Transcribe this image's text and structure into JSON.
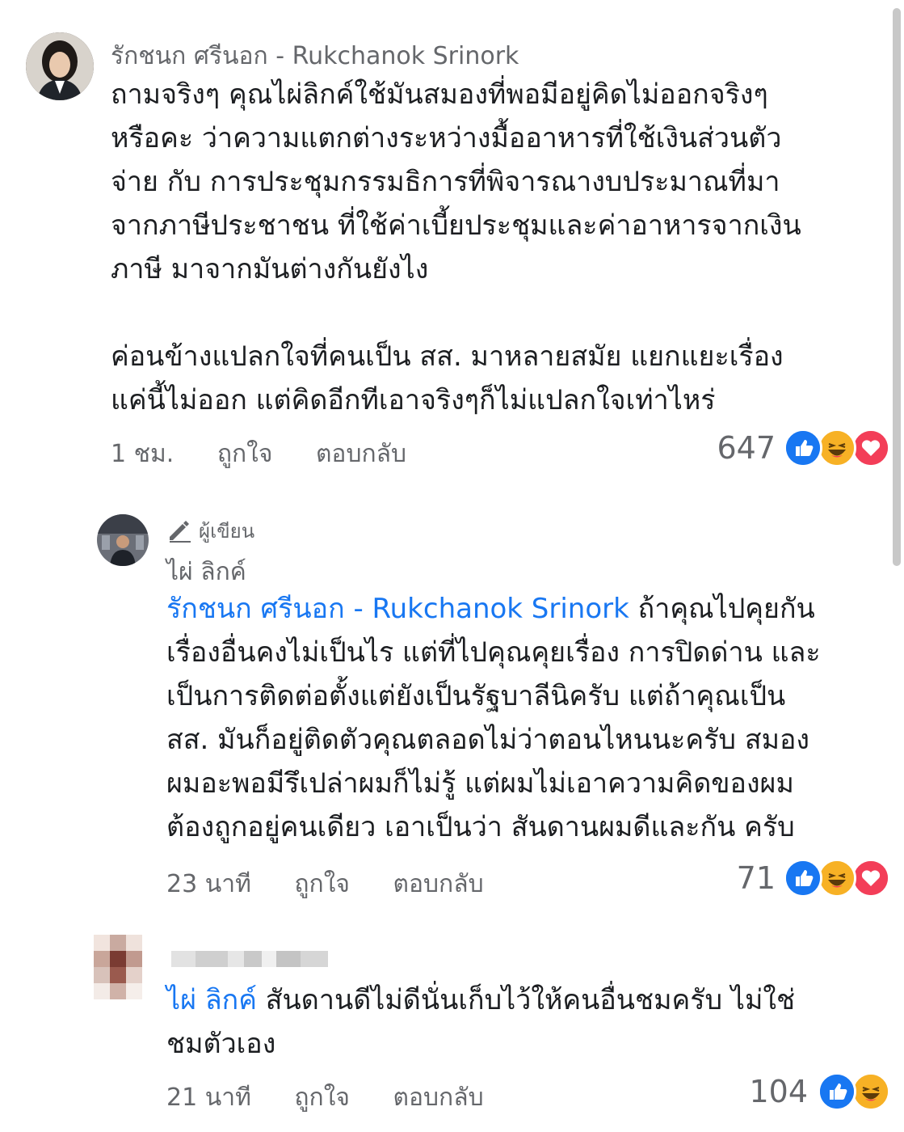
{
  "comments": [
    {
      "author": "รักชนก ศรีนอก - Rukchanok Srinork",
      "text": "ถามจริงๆ คุณไผ่ลิกค์ใช้มันสมองที่พอมีอยู่คิดไม่ออกจริงๆ\nหรือคะ ว่าความแตกต่างระหว่างมื้ออาหารที่ใช้เงินส่วนตัว\nจ่าย กับ การประชุมกรรมธิการที่พิจารณางบประมาณที่มา\nจากภาษีประชาชน ที่ใช้ค่าเบี้ยประชุมและค่าอาหารจากเงิน\nภาษี มาจากมันต่างกันยังไง\n\nค่อนข้างแปลกใจที่คนเป็น สส. มาหลายสมัย แยกแยะเรื่อง\nแค่นี้ไม่ออก แต่คิดอีกทีเอาจริงๆก็ไม่แปลกใจเท่าไหร่",
      "time": "1 ชม.",
      "like_label": "ถูกใจ",
      "reply_label": "ตอบกลับ",
      "reaction_count": "647",
      "reactions": [
        "like-icon",
        "haha-icon",
        "love-icon"
      ]
    },
    {
      "badge": "ผู้เขียน",
      "author": "ไผ่ ลิกค์",
      "mention": "รักชนก ศรีนอก - Rukchanok Srinork",
      "text": " ถ้าคุณไปคุยกัน\nเรื่องอื่นคงไม่เป็นไร แต่ที่ไปคุณคุยเรื่อง การปิดด่าน และ\nเป็นการติดต่อตั้งแต่ยังเป็นรัฐบาลีนิครับ แต่ถ้าคุณเป็น\nสส. มันก็อยู่ติดตัวคุณตลอดไม่ว่าตอนไหนนะครับ สมอง\nผมอะพอมีรึเปล่าผมก็ไม่รู้ แต่ผมไม่เอาความคิดของผม\nต้องถูกอยู่คนเดียว เอาเป็นว่า สันดานผมดีและกัน ครับ",
      "time": "23 นาที",
      "like_label": "ถูกใจ",
      "reply_label": "ตอบกลับ",
      "reaction_count": "71",
      "reactions": [
        "like-icon",
        "haha-icon",
        "love-icon"
      ]
    },
    {
      "mention": "ไผ่ ลิกค์",
      "text": " สันดานดีไม่ดีนั่นเก็บไว้ให้คนอื่นชมครับ ไม่ใช่\nชมตัวเอง",
      "time": "21 นาที",
      "like_label": "ถูกใจ",
      "reply_label": "ตอบกลับ",
      "reaction_count": "104",
      "reactions": [
        "like-icon",
        "haha-icon"
      ]
    }
  ],
  "colors": {
    "like": "#1877f2",
    "haha": "#f7b125",
    "love": "#f33e58",
    "mention": "#1877f2",
    "muted": "#65676b"
  }
}
